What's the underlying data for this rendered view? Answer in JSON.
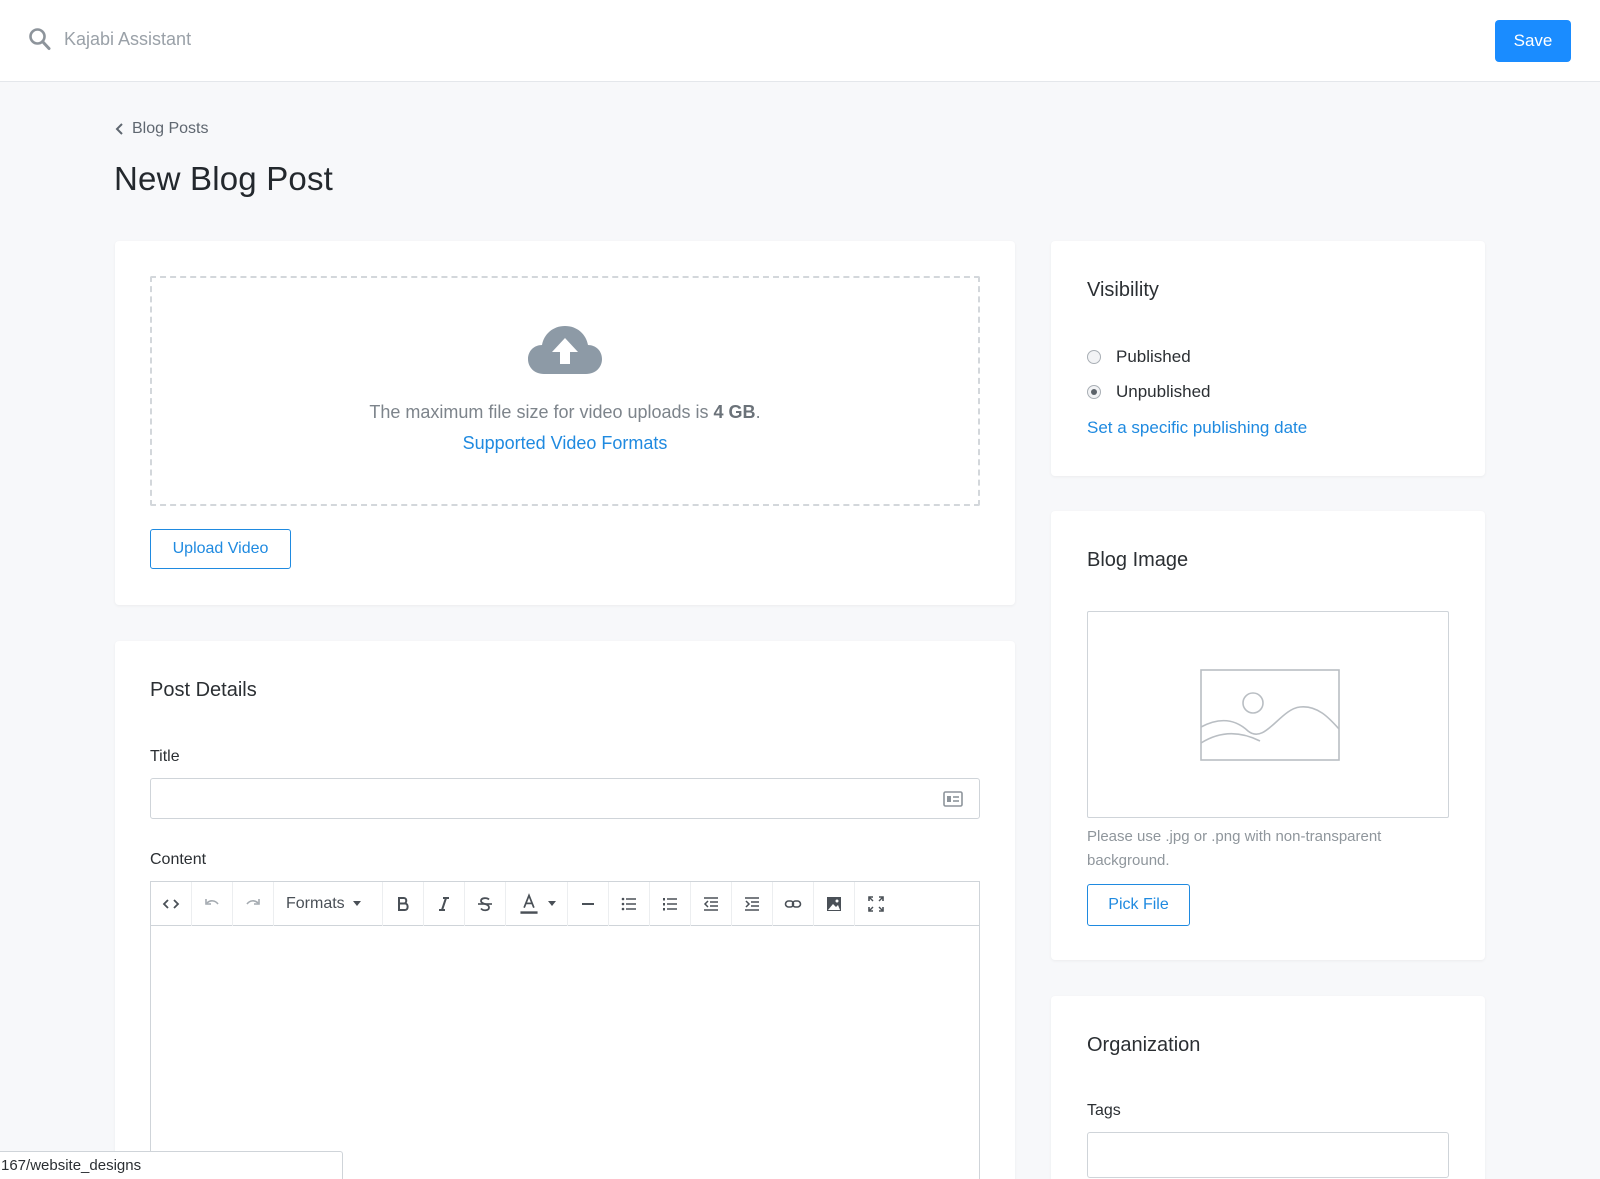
{
  "search": {
    "placeholder": "Kajabi Assistant"
  },
  "header": {
    "save_label": "Save"
  },
  "breadcrumb": {
    "label": "Blog Posts"
  },
  "page": {
    "title": "New Blog Post"
  },
  "upload": {
    "note_prefix": "The maximum file size for video uploads is ",
    "max_size": "4 GB",
    "note_suffix": ".",
    "formats_link": "Supported Video Formats",
    "button_label": "Upload Video"
  },
  "details": {
    "section_title": "Post Details",
    "title_label": "Title",
    "title_value": "",
    "content_label": "Content",
    "toolbar": {
      "formats_label": "Formats",
      "items": [
        "code-view",
        "undo",
        "redo",
        "formats",
        "bold",
        "italic",
        "strikethrough",
        "text-color",
        "horizontal-rule",
        "bullet-list",
        "numbered-list",
        "outdent",
        "indent",
        "link",
        "image",
        "fullscreen"
      ]
    }
  },
  "visibility": {
    "title": "Visibility",
    "options": [
      {
        "label": "Published",
        "checked": false
      },
      {
        "label": "Unpublished",
        "checked": true
      }
    ],
    "date_link": "Set a specific publishing date"
  },
  "blog_image": {
    "title": "Blog Image",
    "hint": "Please use .jpg or .png with non-transparent background.",
    "button_label": "Pick File"
  },
  "organization": {
    "title": "Organization",
    "tags_label": "Tags",
    "tags_value": ""
  },
  "status_bar": {
    "url": "167/website_designs"
  },
  "colors": {
    "accent": "#1a8cff",
    "link": "#1f8ae0",
    "background": "#f7f8fa"
  }
}
